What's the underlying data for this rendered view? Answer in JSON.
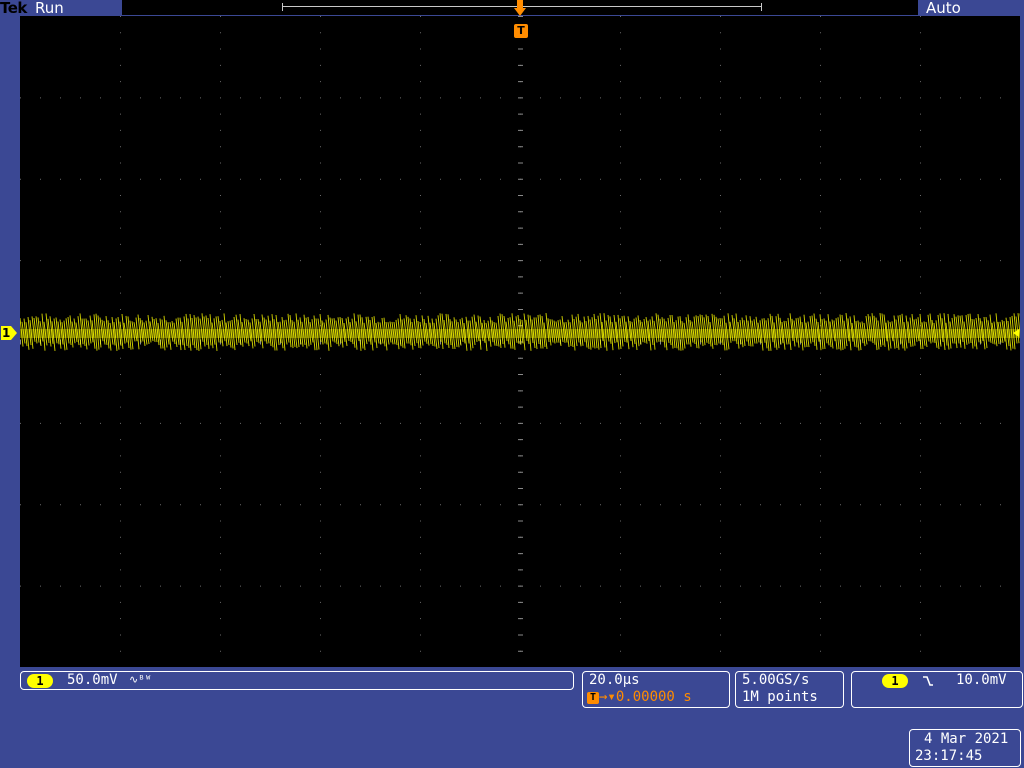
{
  "header": {
    "brand": "Tek",
    "run_status": "Run",
    "trigger_mode": "Auto"
  },
  "graticule": {
    "trigger_marker": "T",
    "channel_marker": "1"
  },
  "channel1": {
    "number": "1",
    "scale": "50.0mV",
    "bandwidth_icon": "∿ᴮᵂ",
    "color": "#ffff00"
  },
  "timebase": {
    "scale": "20.0µs",
    "trigger_delay": "0.00000 s"
  },
  "acquisition": {
    "sample_rate": "5.00GS/s",
    "record_length": "1M points"
  },
  "trigger": {
    "source": "1",
    "slope_icon": "falling-edge-icon",
    "level": "10.0mV"
  },
  "datetime": {
    "date": "4 Mar 2021",
    "time": "23:17:45"
  },
  "colors": {
    "background": "#3b4894",
    "trigger": "#ff8c00",
    "trace": "#ffff00"
  }
}
